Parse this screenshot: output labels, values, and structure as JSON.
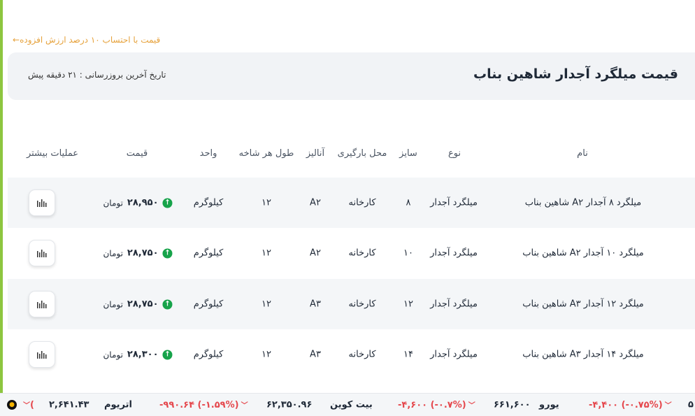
{
  "vat_link": {
    "label": "قیمت با احتساب ۱۰ درصد ارزش افزوده",
    "arrow": "🡠"
  },
  "header": {
    "title": "قیمت میلگرد آجدار شاهین بناب",
    "last_update": "تاریخ آخرین بروزرسانی : ۲۱ دقیقه پیش"
  },
  "columns": {
    "name": "نام",
    "type": "نوع",
    "size": "سایز",
    "location": "محل بارگیری",
    "analysis": "آنالیز",
    "length": "طول هر شاخه",
    "unit": "واحد",
    "price": "قیمت",
    "more": "عملیات بیشتر"
  },
  "rows": [
    {
      "name": "میلگرد ۸ آجدار A۲ شاهین بناب",
      "type": "میلگرد آجدار",
      "size": "۸",
      "location": "کارخانه",
      "analysis": "A۲",
      "length": "۱۲",
      "unit": "کیلوگرم",
      "price": "۲۸,۹۵۰",
      "currency": "تومان"
    },
    {
      "name": "میلگرد ۱۰ آجدار A۲ شاهین بناب",
      "type": "میلگرد آجدار",
      "size": "۱۰",
      "location": "کارخانه",
      "analysis": "A۲",
      "length": "۱۲",
      "unit": "کیلوگرم",
      "price": "۲۸,۷۵۰",
      "currency": "تومان"
    },
    {
      "name": "میلگرد ۱۲ آجدار A۳ شاهین بناب",
      "type": "میلگرد آجدار",
      "size": "۱۲",
      "location": "کارخانه",
      "analysis": "A۳",
      "length": "۱۲",
      "unit": "کیلوگرم",
      "price": "۲۸,۷۵۰",
      "currency": "تومان"
    },
    {
      "name": "میلگرد ۱۴ آجدار A۳ شاهین بناب",
      "type": "میلگرد آجدار",
      "size": "۱۴",
      "location": "کارخانه",
      "analysis": "A۳",
      "length": "۱۲",
      "unit": "کیلوگرم",
      "price": "۲۸,۳۰۰",
      "currency": "تومان"
    }
  ],
  "ticker": {
    "left_partial_change": "( ",
    "ethereum_label": "اتریوم",
    "ethereum_price": "۲,۶۴۱.۴۳",
    "btc_change": "-۹۹۰.۶۴ (-۱.۵۹%)",
    "btc_price": "۶۲,۳۵۰.۹۶",
    "btc_label": "بیت کوین",
    "euro_change": "-۴,۶۰۰ (-۰.۷%)",
    "euro_price": "۶۶۱,۶۰۰",
    "euro_label": "یورو",
    "prev_change": "-۴,۴۰۰ (-۰.۷۵%)",
    "right_partial": "۵",
    "chevron": "﹀"
  },
  "icons": {
    "up_arrow": "up-arrow-circle-icon",
    "chart": "bar-chart-icon",
    "coin": "coin-icon"
  },
  "colors": {
    "up": "#16a34a",
    "down": "#e5484d",
    "link": "#e6a23c",
    "accent": "#8dc63f"
  }
}
